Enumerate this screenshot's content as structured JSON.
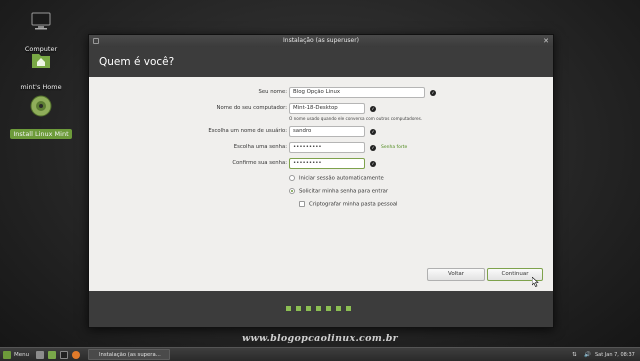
{
  "desktop": {
    "icons": [
      {
        "label": "Computer",
        "icon": "monitor-icon"
      },
      {
        "label": "mint's Home",
        "icon": "home-folder-icon"
      },
      {
        "label": "Install Linux Mint",
        "icon": "cd-disc-icon"
      }
    ]
  },
  "window": {
    "title": "Instalação (as superuser)",
    "heading": "Quem é você?",
    "form": {
      "name_label": "Seu nome:",
      "name_value": "Blog Opção Linux",
      "computer_label": "Nome do seu computador:",
      "computer_value": "Mint-18-Desktop",
      "computer_hint": "O nome usado quando ele conversa com outros computadores.",
      "username_label": "Escolha um nome de usuário:",
      "username_value": "sandro",
      "password_label": "Escolha uma senha:",
      "password_value": "•••••••••",
      "password_strength": "Senha forte",
      "confirm_label": "Confirme sua senha:",
      "confirm_value": "•••••••••"
    },
    "options": {
      "auto_login": "Iniciar sessão automaticamente",
      "require_password": "Solicitar minha senha para entrar",
      "encrypt_home": "Criptografar minha pasta pessoal"
    },
    "buttons": {
      "back": "Voltar",
      "continue": "Continuar"
    },
    "progress": {
      "total_steps": 7,
      "current_step": 7
    }
  },
  "watermark": "www.blogopcaolinux.com.br",
  "taskbar": {
    "menu_label": "Menu",
    "task_label": "Instalação (as supera...",
    "clock": "Sat Jan 7, 08:37"
  },
  "colors": {
    "accent": "#8cbf53",
    "banner": "#3c3c3c",
    "selected_icon_bg": "#6d9b3a"
  }
}
